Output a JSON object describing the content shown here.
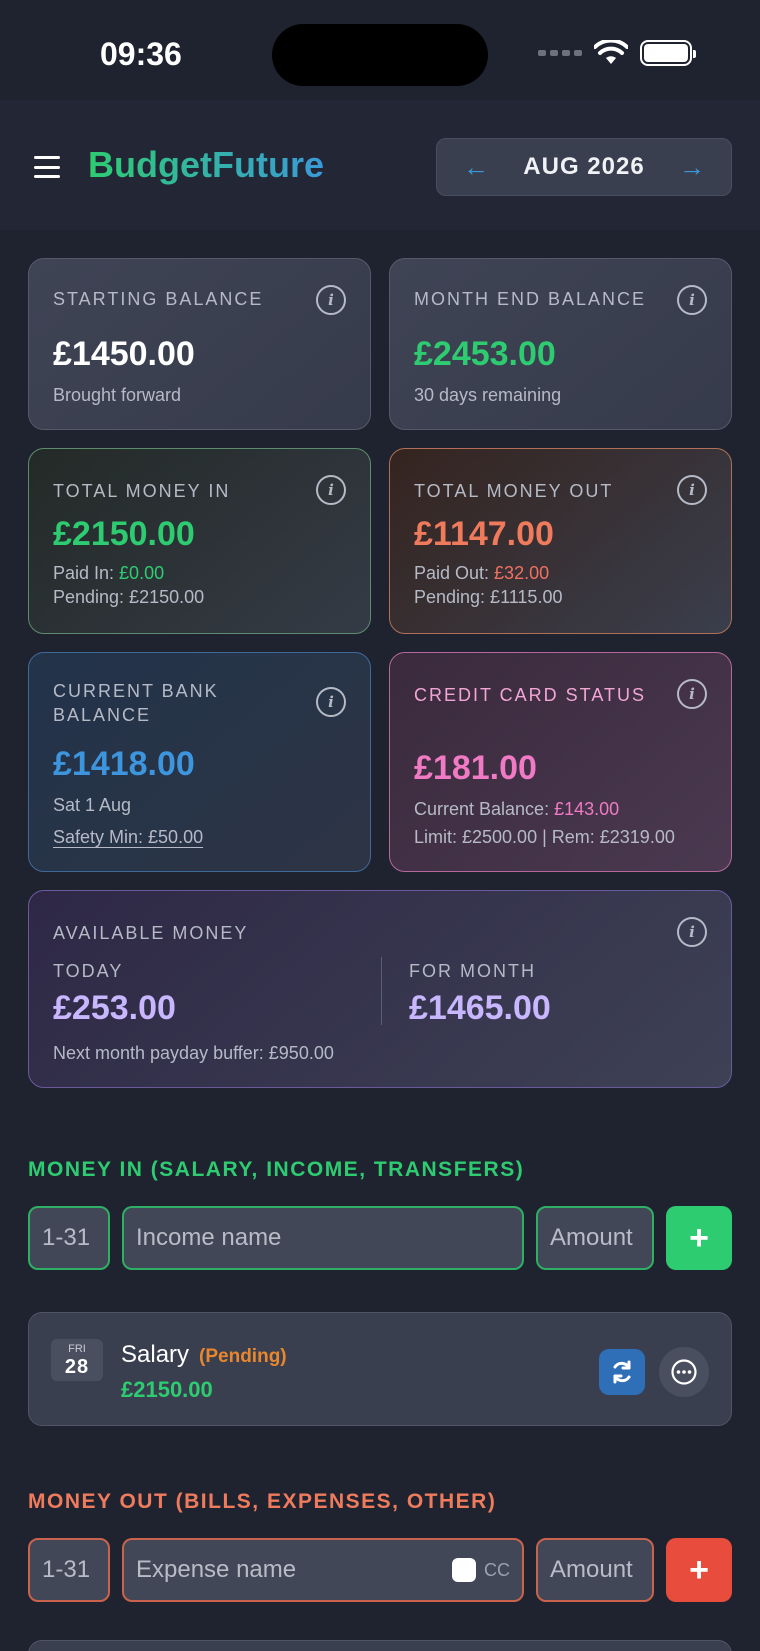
{
  "status_bar": {
    "time": "09:36"
  },
  "header": {
    "app_name": "BudgetFuture",
    "month": "AUG 2026",
    "prev_arrow": "←",
    "next_arrow": "→"
  },
  "cards": {
    "starting_balance": {
      "title": "STARTING BALANCE",
      "value": "£1450.00",
      "sub": "Brought forward"
    },
    "month_end_balance": {
      "title": "MONTH END BALANCE",
      "value": "£2453.00",
      "sub": "30 days remaining"
    },
    "total_money_in": {
      "title": "TOTAL MONEY IN",
      "value": "£2150.00",
      "paid_label": "Paid In: ",
      "paid_value": "£0.00",
      "pending": "Pending: £2150.00"
    },
    "total_money_out": {
      "title": "TOTAL MONEY OUT",
      "value": "£1147.00",
      "paid_label": "Paid Out: ",
      "paid_value": "£32.00",
      "pending": "Pending: £1115.00"
    },
    "current_bank_balance": {
      "title_line1": "CURRENT BANK",
      "title_line2": "BALANCE",
      "value": "£1418.00",
      "date": "Sat 1 Aug",
      "safety": "Safety Min: £50.00"
    },
    "credit_card_status": {
      "title": "CREDIT CARD STATUS",
      "value": "£181.00",
      "current_label": "Current Balance: ",
      "current_value": "£143.00",
      "limit": "Limit: £2500.00 | Rem: £2319.00"
    },
    "available_money": {
      "title": "AVAILABLE MONEY",
      "today_label": "TODAY",
      "today_value": "£253.00",
      "month_label": "FOR MONTH",
      "month_value": "£1465.00",
      "buffer": "Next month payday buffer: £950.00"
    }
  },
  "money_in": {
    "title": "MONEY IN (SALARY, INCOME, TRANSFERS)",
    "day_placeholder": "1-31",
    "name_placeholder": "Income name",
    "amount_placeholder": "Amount",
    "add_label": "+",
    "entries": [
      {
        "dow": "FRI",
        "dom": "28",
        "name": "Salary",
        "status": "(Pending)",
        "amount": "£2150.00"
      }
    ]
  },
  "money_out": {
    "title": "MONEY OUT (BILLS, EXPENSES, OTHER)",
    "day_placeholder": "1-31",
    "name_placeholder": "Expense name",
    "cc_label": "CC",
    "amount_placeholder": "Amount",
    "add_label": "+"
  },
  "colors": {
    "green": "#2ecc71",
    "red": "#e74c3c",
    "blue": "#3d95de",
    "pink": "#f07ac4",
    "lavender": "#c8b6ff",
    "pending_orange": "#e8872e"
  },
  "icons": [
    "menu-icon",
    "info-icon",
    "arrow-left-icon",
    "arrow-right-icon",
    "plus-icon",
    "recurring-icon",
    "more-icon",
    "wifi-icon",
    "battery-icon"
  ]
}
